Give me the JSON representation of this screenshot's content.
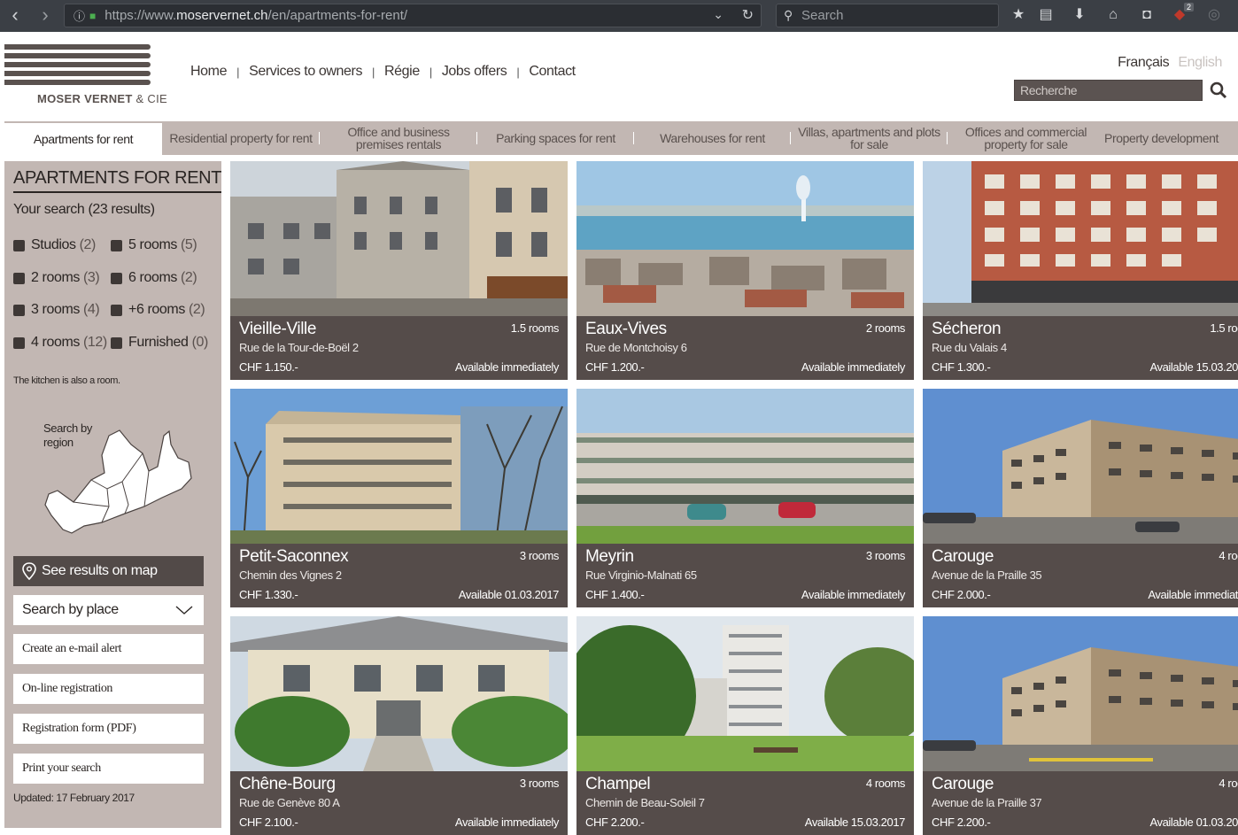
{
  "browser": {
    "url_prefix": "https://www.",
    "url_domain": "moservernet.ch",
    "url_path": "/en/apartments-for-rent/",
    "search_placeholder": "Search",
    "badge_count": "2"
  },
  "header": {
    "logo_text_main": "MOSER VERNET",
    "logo_text_suffix": " & CIE",
    "nav": [
      "Home",
      "Services to owners",
      "Régie",
      "Jobs offers",
      "Contact"
    ],
    "lang_fr": "Français",
    "lang_en": "English",
    "search_placeholder": "Recherche"
  },
  "tabs": [
    "Apartments for rent",
    "Residential property for rent",
    "Office and business premises rentals",
    "Parking spaces for rent",
    "Warehouses for rent",
    "Villas, apartments and plots for sale",
    "Offices and commercial property for sale",
    "Property development"
  ],
  "sidebar": {
    "title": "APARTMENTS FOR RENT",
    "results": "Your search (23 results)",
    "filters": [
      {
        "label": "Studios",
        "count": "(2)"
      },
      {
        "label": "5 rooms",
        "count": "(5)"
      },
      {
        "label": "2 rooms",
        "count": "(3)"
      },
      {
        "label": "6 rooms",
        "count": "(2)"
      },
      {
        "label": "3 rooms",
        "count": "(4)"
      },
      {
        "label": "+6 rooms",
        "count": "(2)"
      },
      {
        "label": "4 rooms",
        "count": "(12)"
      },
      {
        "label": "Furnished",
        "count": "(0)"
      }
    ],
    "note": "The kitchen is also a room.",
    "map_label_1": "Search by",
    "map_label_2": "region",
    "map_button": "See results on map",
    "place_select": "Search by place",
    "buttons": [
      "Create an e-mail alert",
      "On-line registration",
      "Registration form (PDF)",
      "Print your search"
    ],
    "updated": "Updated: 17 February 2017"
  },
  "listings": [
    {
      "place": "Vieille-Ville",
      "rooms": "1.5 rooms",
      "street": "Rue de la Tour-de-Boël 2",
      "price": "CHF 1.150.-",
      "available": "Available immediately"
    },
    {
      "place": "Eaux-Vives",
      "rooms": "2 rooms",
      "street": "Rue de Montchoisy 6",
      "price": "CHF 1.200.-",
      "available": "Available immediately"
    },
    {
      "place": "Sécheron",
      "rooms": "1.5 roo",
      "street": "Rue du Valais 4",
      "price": "CHF 1.300.-",
      "available": "Available 15.03.20"
    },
    {
      "place": "Petit-Saconnex",
      "rooms": "3 rooms",
      "street": "Chemin des Vignes 2",
      "price": "CHF 1.330.-",
      "available": "Available 01.03.2017"
    },
    {
      "place": "Meyrin",
      "rooms": "3 rooms",
      "street": "Rue Virginio-Malnati 65",
      "price": "CHF 1.400.-",
      "available": "Available immediately"
    },
    {
      "place": "Carouge",
      "rooms": "4 roo",
      "street": "Avenue de la Praille 35",
      "price": "CHF 2.000.-",
      "available": "Available immediat"
    },
    {
      "place": "Chêne-Bourg",
      "rooms": "3 rooms",
      "street": "Rue de Genève 80 A",
      "price": "CHF 2.100.-",
      "available": "Available immediately"
    },
    {
      "place": "Champel",
      "rooms": "4 rooms",
      "street": "Chemin de Beau-Soleil 7",
      "price": "CHF 2.200.-",
      "available": "Available 15.03.2017"
    },
    {
      "place": "Carouge",
      "rooms": "4 roo",
      "street": "Avenue de la Praille 37",
      "price": "CHF 2.200.-",
      "available": "Available 01.03.20"
    }
  ]
}
